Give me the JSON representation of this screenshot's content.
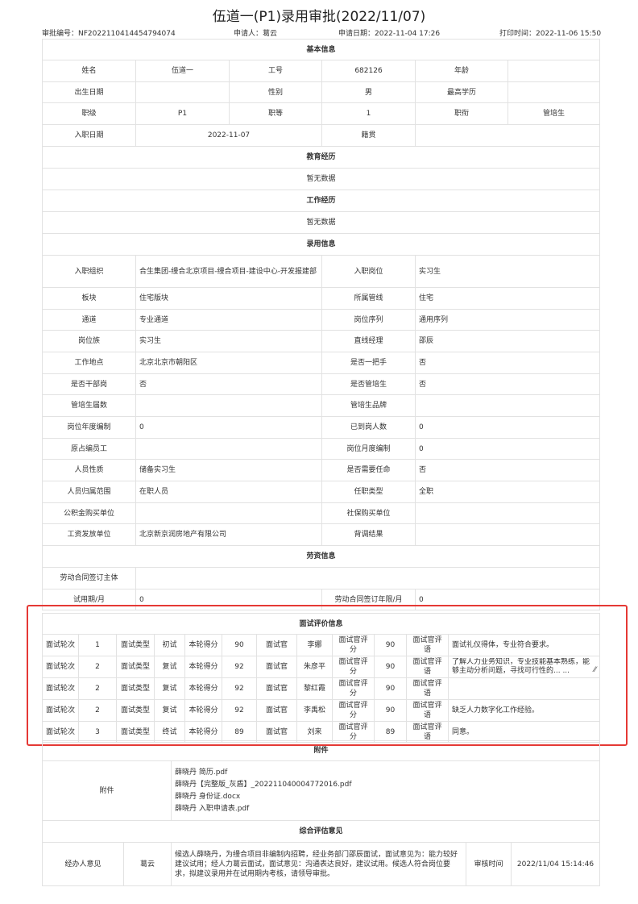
{
  "title": "伍道一(P1)录用审批(2022/11/07)",
  "meta": {
    "approval_no": "审批编号：NF2022110414454794074",
    "applicant": "申请人：葛云",
    "apply_date": "申请日期：2022-11-04 17:26",
    "print_time": "打印时间：2022-11-06 15:50"
  },
  "basic": {
    "section": "基本信息",
    "rows": [
      [
        "姓名",
        "伍道一",
        "工号",
        "682126",
        "年龄",
        ""
      ],
      [
        "出生日期",
        "",
        "性别",
        "男",
        "最高学历",
        ""
      ],
      [
        "职级",
        "P1",
        "职等",
        "1",
        "职衔",
        "管培生"
      ]
    ],
    "entry_label": "入职日期",
    "entry_value": "2022-11-07",
    "origin_label": "籍贯",
    "origin_value": ""
  },
  "education": {
    "section": "教育经历",
    "empty": "暂无数据"
  },
  "work": {
    "section": "工作经历",
    "empty": "暂无数据"
  },
  "hire": {
    "section": "录用信息",
    "org_label": "入职组织",
    "org_value": "合生集团-缦合北京项目-缦合项目-建设中心-开发报建部",
    "post_label": "入职岗位",
    "post_value": "实习生",
    "rows": [
      [
        "板块",
        "住宅版块",
        "所属管线",
        "住宅"
      ],
      [
        "通道",
        "专业通道",
        "岗位序列",
        "通用序列"
      ],
      [
        "岗位族",
        "实习生",
        "直线经理",
        "邵辰"
      ],
      [
        "工作地点",
        "北京北京市朝阳区",
        "是否一把手",
        "否"
      ],
      [
        "是否干部岗",
        "否",
        "是否管培生",
        "否"
      ],
      [
        "管培生届数",
        "",
        "管培生品牌",
        ""
      ],
      [
        "岗位年度编制",
        "0",
        "已到岗人数",
        "0"
      ],
      [
        "原占编员工",
        "",
        "岗位月度编制",
        "0"
      ],
      [
        "人员性质",
        "储备实习生",
        "是否需要任命",
        "否"
      ],
      [
        "人员归属范围",
        "在职人员",
        "任职类型",
        "全职"
      ],
      [
        "公积金购买单位",
        "",
        "社保购买单位",
        ""
      ],
      [
        "工资发放单位",
        "北京新京润房地产有限公司",
        "背调结果",
        ""
      ]
    ]
  },
  "labor": {
    "section": "劳资信息",
    "contract_label": "劳动合同签订主体",
    "contract_value": "",
    "probation_label": "试用期/月",
    "probation_value": "0",
    "term_label": "劳动合同签订年限/月",
    "term_value": "0"
  },
  "interview": {
    "section": "面试评价信息",
    "labels": {
      "round": "面试轮次",
      "type": "面试类型",
      "score": "本轮得分",
      "interviewer": "面试官",
      "rating": "面试官评分",
      "comment": "面试官评语"
    },
    "rows": [
      {
        "round": "1",
        "type": "初试",
        "score": "90",
        "interviewer": "李娜",
        "rating": "90",
        "comment": "面试礼仪得体，专业符合要求。"
      },
      {
        "round": "2",
        "type": "复试",
        "score": "92",
        "interviewer": "朱彦平",
        "rating": "90",
        "comment": "了解人力业务知识，专业技能基本熟练，能够主动分析问题，寻找可行性的... ..."
      },
      {
        "round": "2",
        "type": "复试",
        "score": "92",
        "interviewer": "黎红霞",
        "rating": "90",
        "comment": ""
      },
      {
        "round": "2",
        "type": "复试",
        "score": "92",
        "interviewer": "李禹松",
        "rating": "90",
        "comment": "缺乏人力数字化工作经验。"
      },
      {
        "round": "3",
        "type": "终试",
        "score": "89",
        "interviewer": "刘来",
        "rating": "89",
        "comment": "同意。"
      }
    ]
  },
  "attachments": {
    "section": "附件",
    "label": "附件",
    "files": [
      "薛晓丹 简历.pdf",
      "薛晓丹【完整版_灰盾】_202211040004772016.pdf",
      "薛晓丹 身份证.docx",
      "薛晓丹 入职申请表.pdf"
    ]
  },
  "assessment": {
    "section": "综合评估意见",
    "label": "经办人意见",
    "person": "葛云",
    "opinion": "候选人薛晓丹，为缦合项目非编制内招聘，经业务部门邵辰面试，面试意见为：能力较好建议试用；经人力葛云面试，面试意见：沟通表达良好，建议试用。候选人符合岗位要求，拟建议录用并在试用期内考核，请领导审批。",
    "time_label": "审核时间",
    "time_value": "2022/11/04 15:14:46"
  }
}
